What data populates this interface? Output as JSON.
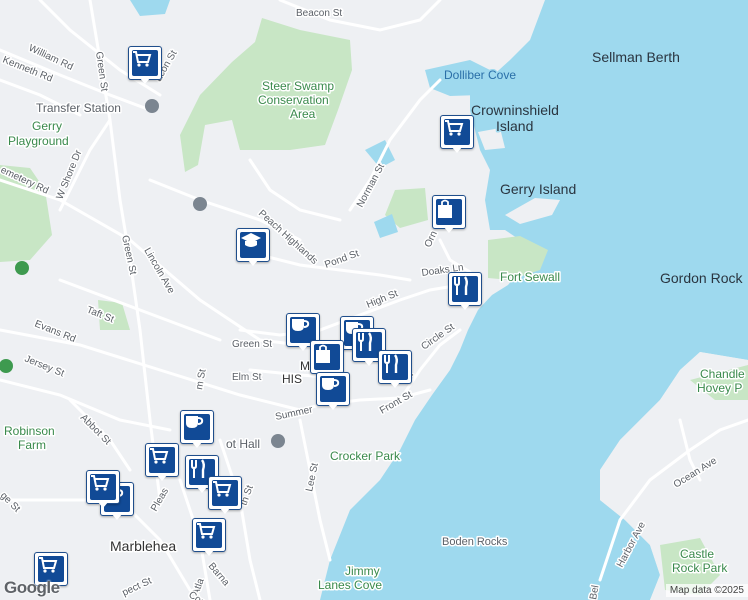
{
  "colors": {
    "water": "#9ed9ee",
    "land": "#eef0f3",
    "park": "#c8e6c5",
    "road": "#ffffff",
    "marker_fill": "#114a96"
  },
  "street_labels": {
    "beacon": "Beacon St",
    "william": "William Rd",
    "kenneth": "Kenneth Rd",
    "green_n": "Green St",
    "acon": "acon St",
    "w_shore": "W Shore Dr",
    "cemetery": "emetery Rd",
    "green_w": "Green St",
    "lincoln": "Lincoln Ave",
    "taft": "Taft St",
    "evans": "Evans Rd",
    "jersey": "Jersey St",
    "abbot": "Abbot St",
    "ge": "ge St",
    "peach": "Peach Highlands",
    "pond": "Pond St",
    "norman": "Norman St",
    "high": "High St",
    "green_c": "Green St",
    "elm": "Elm St",
    "summer": "Summer",
    "front": "Front St",
    "circle": "Circle St",
    "doaks": "Doaks Ln",
    "orne": "Orn",
    "lee": "Lee St",
    "pleas": "Pleas",
    "m_st": "m St",
    "th_st": "th St",
    "atl": "Atla",
    "barn": "Barna",
    "spect": "pect St",
    "com": "Com",
    "harbor": "Harbor Ave",
    "ocean": "Ocean Ave",
    "bel": "Bel"
  },
  "place_labels": {
    "transfer": "Transfer Station",
    "gerry_play_1": "Gerry",
    "gerry_play_2": "Playground",
    "steer_1": "Steer Swamp",
    "steer_2": "Conservation",
    "steer_3": "Area",
    "dolliber": "Dolliber Cove",
    "sellman": "Sellman Berth",
    "crown_1": "Crowninshield",
    "crown_2": "Island",
    "gerry_island": "Gerry Island",
    "fort": "Fort Sewall",
    "gordon": "Gordon Rock",
    "chandler_1": "Chandle",
    "chandler_2": "Hovey P",
    "robinson_1": "Robinson",
    "robinson_2": "Farm",
    "abbot_hall": "ot Hall",
    "crocker": "Crocker Park",
    "boden": "Boden Rocks",
    "jimmy_1": "Jimmy",
    "jimmy_2": "Lanes Cove",
    "castle_1": "Castle",
    "castle_2": "Rock Park",
    "marblehead": "Marblehea",
    "historic_1": "M",
    "historic_2": "HIS",
    "historic_3": "T"
  },
  "markers": [
    {
      "icon": "cart"
    },
    {
      "icon": "cart"
    },
    {
      "icon": "bag"
    },
    {
      "icon": "school"
    },
    {
      "icon": "fork-knife"
    },
    {
      "icon": "coffee"
    },
    {
      "icon": "coffee"
    },
    {
      "icon": "fork-knife"
    },
    {
      "icon": "bag"
    },
    {
      "icon": "fork-knife"
    },
    {
      "icon": "coffee"
    },
    {
      "icon": "coffee"
    },
    {
      "icon": "cart"
    },
    {
      "icon": "fork-knife"
    },
    {
      "icon": "cart"
    },
    {
      "icon": "coffee"
    },
    {
      "icon": "cart"
    },
    {
      "icon": "cart"
    },
    {
      "icon": "cart"
    }
  ],
  "footer": {
    "logo": "Google",
    "attribution": "Map data ©2025"
  }
}
